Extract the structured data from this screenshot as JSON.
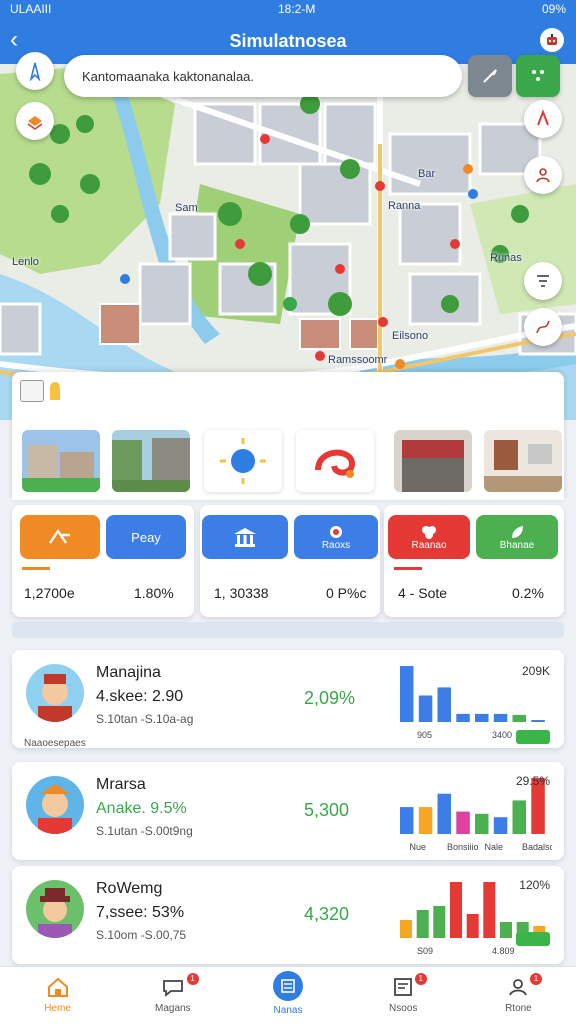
{
  "status": {
    "time": "18:2-M",
    "battery": "09%",
    "carrier": "ULAAIII"
  },
  "appbar": {
    "title": "Simulatnosea"
  },
  "search": {
    "value": "Kantomaanaka kaktonanalaa."
  },
  "map": {
    "labels": [
      "Lenlo",
      "Sam",
      "Bar",
      "Ranna",
      "Runas",
      "Eilsono",
      "Ramssoomr"
    ]
  },
  "stats": [
    {
      "buttons": [
        {
          "label": "",
          "color": "#f08a24"
        },
        {
          "label": "Peay",
          "color": "#3c7ee6"
        }
      ],
      "values": [
        "1,2700e",
        "1.80%"
      ]
    },
    {
      "buttons": [
        {
          "label": "",
          "color": "#3c7ee6"
        },
        {
          "label": "Raoxs",
          "color": "#3c7ee6"
        }
      ],
      "values": [
        "1, 30338",
        "0 P%c"
      ]
    },
    {
      "buttons": [
        {
          "label": "Raanao",
          "color": "#e53935"
        },
        {
          "label": "Bhanae",
          "color": "#4caf50"
        }
      ],
      "values": [
        "4 - Sote",
        "0.2%"
      ]
    }
  ],
  "list": [
    {
      "name": "Manajina",
      "stat": "4.skee: 2.90",
      "sub": "S.10tan -S.10a-ag",
      "pct": "2,09%",
      "top": "209K",
      "bars": [
        {
          "value": 55,
          "color": "#3c7ee6"
        },
        {
          "value": 26,
          "color": "#3c7ee6"
        },
        {
          "value": 34,
          "color": "#3c7ee6"
        },
        {
          "value": 8,
          "color": "#3c7ee6"
        },
        {
          "value": 8,
          "color": "#3c7ee6"
        },
        {
          "value": 8,
          "color": "#3c7ee6"
        },
        {
          "value": 7,
          "color": "#4caf50"
        },
        {
          "value": 2,
          "color": "#3c7ee6"
        }
      ],
      "xlabels": [
        "905",
        "3400"
      ],
      "badge": "",
      "footer": "Naaoesepaes"
    },
    {
      "name": "Mrarsa",
      "stat": "Anake. 9.5%",
      "sub": "S.1utan -S.00t9ng",
      "pct": "5,300",
      "top": "29.5%",
      "bars": [
        {
          "value": 24,
          "color": "#3c7ee6"
        },
        {
          "value": 24,
          "color": "#f5a623"
        },
        {
          "value": 36,
          "color": "#3c7ee6"
        },
        {
          "value": 20,
          "color": "#e040a0"
        },
        {
          "value": 18,
          "color": "#4caf50"
        },
        {
          "value": 15,
          "color": "#3c7ee6"
        },
        {
          "value": 30,
          "color": "#4caf50"
        },
        {
          "value": 50,
          "color": "#e53935"
        }
      ],
      "xlabels": [
        "Nue",
        "Bonsiiio",
        "Nale",
        "Badalsoe"
      ],
      "badge": "",
      "footer": ""
    },
    {
      "name": "RoWemg",
      "stat": "7,ssee: 53%",
      "sub": "S.10om -S.00,75",
      "pct": "4,320",
      "top": "120%",
      "bars": [
        {
          "value": 9,
          "color": "#f5a623"
        },
        {
          "value": 14,
          "color": "#4caf50"
        },
        {
          "value": 16,
          "color": "#4caf50"
        },
        {
          "value": 28,
          "color": "#e53935"
        },
        {
          "value": 12,
          "color": "#e53935"
        },
        {
          "value": 28,
          "color": "#e53935"
        },
        {
          "value": 8,
          "color": "#4caf50"
        },
        {
          "value": 8,
          "color": "#4caf50"
        },
        {
          "value": 6,
          "color": "#f5a623"
        }
      ],
      "xlabels": [
        "S09",
        "4.809"
      ],
      "badge": "",
      "footer": ""
    }
  ],
  "tabs": [
    {
      "label": "Heme",
      "icon": "home-icon",
      "badge": ""
    },
    {
      "label": "Magans",
      "icon": "chat-icon",
      "badge": "1"
    },
    {
      "label": "Nanas",
      "icon": "list-icon",
      "badge": ""
    },
    {
      "label": "Nsoos",
      "icon": "news-icon",
      "badge": "1"
    },
    {
      "label": "Rtone",
      "icon": "profile-icon",
      "badge": "1"
    }
  ],
  "colors": {
    "primary": "#2f7de1",
    "green": "#3aa84a",
    "red": "#e53935",
    "orange": "#f08a24"
  }
}
